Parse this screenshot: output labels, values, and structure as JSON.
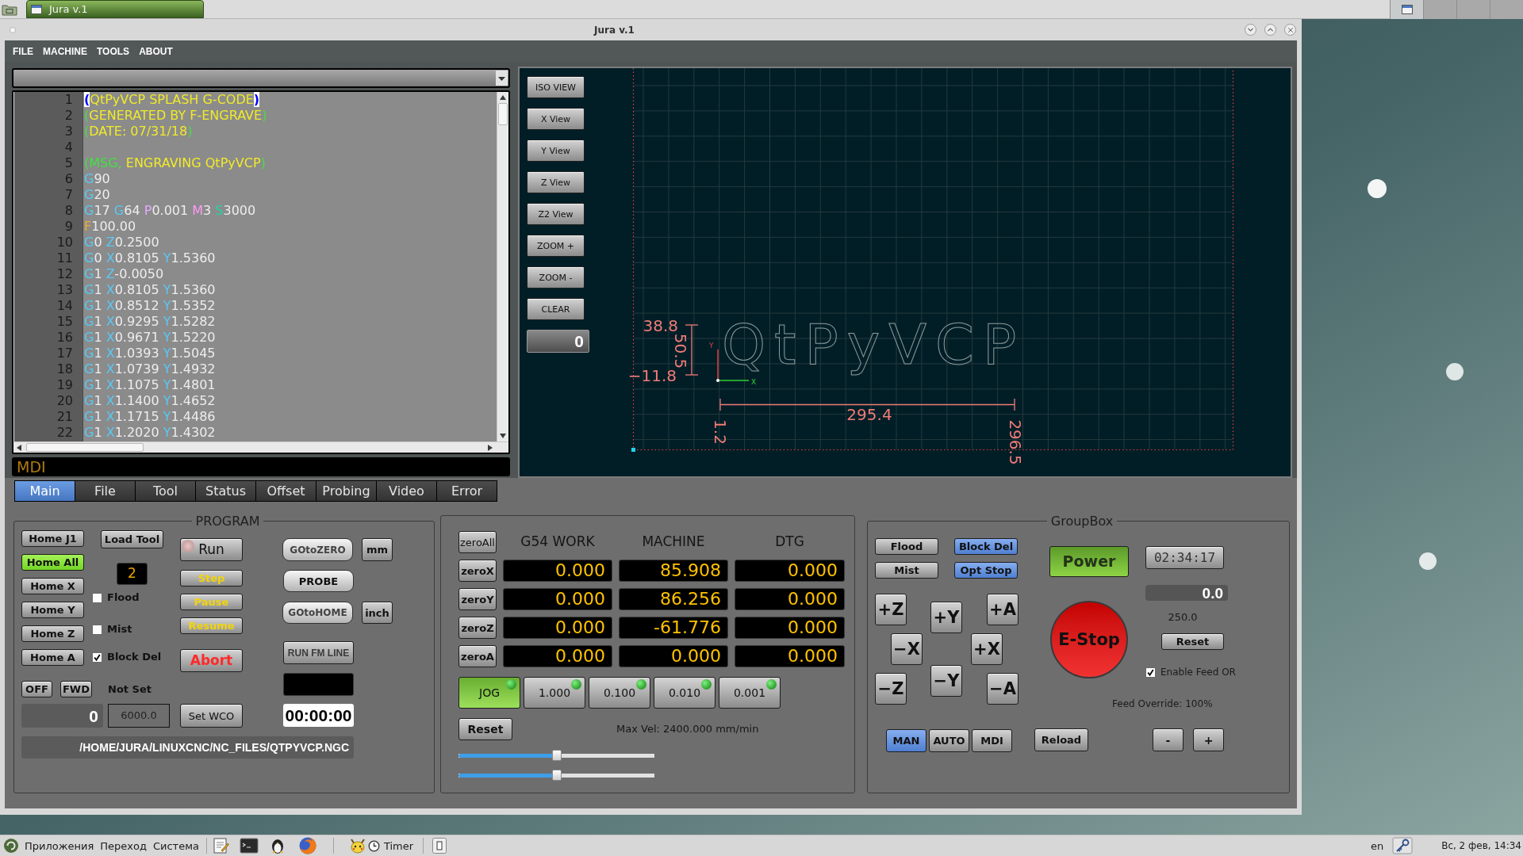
{
  "top_bar": {
    "window_buttons": [
      {
        "title": "Jura v.1",
        "selected": true
      }
    ],
    "workspaces": [
      {
        "selected": true
      },
      {
        "selected": false
      },
      {
        "selected": false
      },
      {
        "selected": false
      }
    ]
  },
  "window": {
    "title": "Jura v.1"
  },
  "menu": [
    "FILE",
    "MACHINE",
    "TOOLS",
    "ABOUT"
  ],
  "editor": {
    "lines": [
      {
        "number": "1",
        "tokens": [
          {
            "kind": "matched_paren",
            "text": "("
          },
          {
            "kind": "comment",
            "text": "QtPyVCP SPLASH G-CODE"
          },
          {
            "kind": "matched_paren",
            "text": ")"
          }
        ]
      },
      {
        "number": "2",
        "tokens": [
          {
            "kind": "paren",
            "text": "("
          },
          {
            "kind": "comment",
            "text": "GENERATED BY F-ENGRAVE"
          },
          {
            "kind": "paren",
            "text": ")"
          }
        ]
      },
      {
        "number": "3",
        "tokens": [
          {
            "kind": "paren",
            "text": "("
          },
          {
            "kind": "comment",
            "text": "DATE: 07/31/18"
          },
          {
            "kind": "paren",
            "text": ")"
          }
        ]
      },
      {
        "number": "4"
      },
      {
        "number": "5",
        "tokens": [
          {
            "kind": "paren",
            "text": "("
          },
          {
            "kind": "msg",
            "text": "MSG,"
          },
          {
            "kind": "comment",
            "text": " ENGRAVING QtPyVCP"
          },
          {
            "kind": "paren",
            "text": ")"
          }
        ]
      },
      {
        "number": "6",
        "tokens": [
          {
            "kind": "gcode",
            "text": "G"
          },
          {
            "kind": "value",
            "text": "90"
          }
        ]
      },
      {
        "number": "7",
        "tokens": [
          {
            "kind": "gcode",
            "text": "G"
          },
          {
            "kind": "value",
            "text": "20"
          }
        ]
      },
      {
        "number": "8",
        "tokens": [
          {
            "kind": "gcode",
            "text": "G"
          },
          {
            "kind": "value",
            "text": "17 "
          },
          {
            "kind": "gcode",
            "text": "G"
          },
          {
            "kind": "value",
            "text": "64 "
          },
          {
            "kind": "p_word",
            "text": "P"
          },
          {
            "kind": "value",
            "text": "0.001 "
          },
          {
            "kind": "m_word",
            "text": "M"
          },
          {
            "kind": "value",
            "text": "3 "
          },
          {
            "kind": "s_word",
            "text": "S"
          },
          {
            "kind": "value",
            "text": "3000"
          }
        ]
      },
      {
        "number": "9",
        "tokens": [
          {
            "kind": "f_word",
            "text": "F"
          },
          {
            "kind": "value",
            "text": "100.00"
          }
        ]
      },
      {
        "number": "10",
        "tokens": [
          {
            "kind": "gcode",
            "text": "G"
          },
          {
            "kind": "value",
            "text": "0 "
          },
          {
            "kind": "axis",
            "text": "Z"
          },
          {
            "kind": "value",
            "text": "0.2500"
          }
        ]
      },
      {
        "number": "11",
        "tokens": [
          {
            "kind": "gcode",
            "text": "G"
          },
          {
            "kind": "value",
            "text": "0 "
          },
          {
            "kind": "axis",
            "text": "X"
          },
          {
            "kind": "value",
            "text": "0.8105 "
          },
          {
            "kind": "axis",
            "text": "Y"
          },
          {
            "kind": "value",
            "text": "1.5360"
          }
        ]
      },
      {
        "number": "12",
        "tokens": [
          {
            "kind": "gcode",
            "text": "G"
          },
          {
            "kind": "value",
            "text": "1 "
          },
          {
            "kind": "axis",
            "text": "Z"
          },
          {
            "kind": "value",
            "text": "-0.0050"
          }
        ]
      },
      {
        "number": "13",
        "tokens": [
          {
            "kind": "gcode",
            "text": "G"
          },
          {
            "kind": "value",
            "text": "1 "
          },
          {
            "kind": "axis",
            "text": "X"
          },
          {
            "kind": "value",
            "text": "0.8105 "
          },
          {
            "kind": "axis",
            "text": "Y"
          },
          {
            "kind": "value",
            "text": "1.5360"
          }
        ]
      },
      {
        "number": "14",
        "tokens": [
          {
            "kind": "gcode",
            "text": "G"
          },
          {
            "kind": "value",
            "text": "1 "
          },
          {
            "kind": "axis",
            "text": "X"
          },
          {
            "kind": "value",
            "text": "0.8512 "
          },
          {
            "kind": "axis",
            "text": "Y"
          },
          {
            "kind": "value",
            "text": "1.5352"
          }
        ]
      },
      {
        "number": "15",
        "tokens": [
          {
            "kind": "gcode",
            "text": "G"
          },
          {
            "kind": "value",
            "text": "1 "
          },
          {
            "kind": "axis",
            "text": "X"
          },
          {
            "kind": "value",
            "text": "0.9295 "
          },
          {
            "kind": "axis",
            "text": "Y"
          },
          {
            "kind": "value",
            "text": "1.5282"
          }
        ]
      },
      {
        "number": "16",
        "tokens": [
          {
            "kind": "gcode",
            "text": "G"
          },
          {
            "kind": "value",
            "text": "1 "
          },
          {
            "kind": "axis",
            "text": "X"
          },
          {
            "kind": "value",
            "text": "0.9671 "
          },
          {
            "kind": "axis",
            "text": "Y"
          },
          {
            "kind": "value",
            "text": "1.5220"
          }
        ]
      },
      {
        "number": "17",
        "tokens": [
          {
            "kind": "gcode",
            "text": "G"
          },
          {
            "kind": "value",
            "text": "1 "
          },
          {
            "kind": "axis",
            "text": "X"
          },
          {
            "kind": "value",
            "text": "1.0393 "
          },
          {
            "kind": "axis",
            "text": "Y"
          },
          {
            "kind": "value",
            "text": "1.5045"
          }
        ]
      },
      {
        "number": "18",
        "tokens": [
          {
            "kind": "gcode",
            "text": "G"
          },
          {
            "kind": "value",
            "text": "1 "
          },
          {
            "kind": "axis",
            "text": "X"
          },
          {
            "kind": "value",
            "text": "1.0739 "
          },
          {
            "kind": "axis",
            "text": "Y"
          },
          {
            "kind": "value",
            "text": "1.4932"
          }
        ]
      },
      {
        "number": "19",
        "tokens": [
          {
            "kind": "gcode",
            "text": "G"
          },
          {
            "kind": "value",
            "text": "1 "
          },
          {
            "kind": "axis",
            "text": "X"
          },
          {
            "kind": "value",
            "text": "1.1075 "
          },
          {
            "kind": "axis",
            "text": "Y"
          },
          {
            "kind": "value",
            "text": "1.4801"
          }
        ]
      },
      {
        "number": "20",
        "tokens": [
          {
            "kind": "gcode",
            "text": "G"
          },
          {
            "kind": "value",
            "text": "1 "
          },
          {
            "kind": "axis",
            "text": "X"
          },
          {
            "kind": "value",
            "text": "1.1400 "
          },
          {
            "kind": "axis",
            "text": "Y"
          },
          {
            "kind": "value",
            "text": "1.4652"
          }
        ]
      },
      {
        "number": "21",
        "tokens": [
          {
            "kind": "gcode",
            "text": "G"
          },
          {
            "kind": "value",
            "text": "1 "
          },
          {
            "kind": "axis",
            "text": "X"
          },
          {
            "kind": "value",
            "text": "1.1715 "
          },
          {
            "kind": "axis",
            "text": "Y"
          },
          {
            "kind": "value",
            "text": "1.4486"
          }
        ]
      },
      {
        "number": "22",
        "tokens": [
          {
            "kind": "gcode",
            "text": "G"
          },
          {
            "kind": "value",
            "text": "1 "
          },
          {
            "kind": "axis",
            "text": "X"
          },
          {
            "kind": "value",
            "text": "1.2020 "
          },
          {
            "kind": "axis",
            "text": "Y"
          },
          {
            "kind": "value",
            "text": "1.4302"
          }
        ]
      }
    ]
  },
  "mdi": {
    "placeholder": "MDI"
  },
  "preview": {
    "view_buttons": [
      "ISO VIEW",
      "X View",
      "Y View",
      "Z View",
      "Z2 View",
      "ZOOM +",
      "ZOOM -",
      "CLEAR"
    ],
    "view_counter": "0",
    "toolpath_text": "QtPyVCP",
    "axis_labels": {
      "y": "Y",
      "x": "X"
    },
    "dimensions": {
      "y_max": "38.8",
      "y_size": "50.5",
      "y_min": "−11.8",
      "x_size": "295.4",
      "x_min": "1.2",
      "x_max": "296.5"
    }
  },
  "tabs": [
    {
      "label": "Main",
      "selected": true
    },
    {
      "label": "File",
      "selected": false
    },
    {
      "label": "Tool",
      "selected": false
    },
    {
      "label": "Status",
      "selected": false
    },
    {
      "label": "Offset",
      "selected": false
    },
    {
      "label": "Probing",
      "selected": false
    },
    {
      "label": "Video",
      "selected": false
    },
    {
      "label": "Error",
      "selected": false
    }
  ],
  "program": {
    "title": "PROGRAM",
    "home_buttons": [
      {
        "label": "Home J1",
        "active": false
      },
      {
        "label": "Home All",
        "active": true
      },
      {
        "label": "Home X",
        "active": false
      },
      {
        "label": "Home Y",
        "active": false
      },
      {
        "label": "Home Z",
        "active": false
      },
      {
        "label": "Home A",
        "active": false
      }
    ],
    "load_tool": "Load Tool",
    "tool_number": "2",
    "checks": [
      {
        "label": "Flood",
        "checked": false
      },
      {
        "label": "Mist",
        "checked": false
      },
      {
        "label": "Block Del",
        "checked": true
      }
    ],
    "run_led": {
      "on": false
    },
    "run_controls": [
      {
        "label": "Run",
        "kind": "run"
      },
      {
        "label": "Step",
        "kind": "action"
      },
      {
        "label": "Pause",
        "kind": "action"
      },
      {
        "label": "Resume",
        "kind": "action"
      },
      {
        "label": "Abort",
        "kind": "abort"
      }
    ],
    "goto_buttons": [
      "GOtoZERO",
      "PROBE",
      "GOtoHOME"
    ],
    "unit_buttons": [
      "mm",
      "inch"
    ],
    "run_from_line": "RUN FM LINE",
    "elapsed_time": "00:00:00",
    "spindle_buttons": [
      "OFF",
      "FWD"
    ],
    "spindle_status": "Not Set",
    "spindle_speed": "0",
    "spindle_max": "6000.0",
    "set_wco": "Set WCO",
    "file_path": "/HOME/JURA/LINUXCNC/NC_FILES/QTPYVCP.NGC"
  },
  "dro": {
    "zero_all": "zeroAll",
    "columns": [
      "G54 WORK",
      "MACHINE",
      "DTG"
    ],
    "rows": [
      {
        "button": "zeroX",
        "values": [
          "0.000",
          "85.908",
          "0.000"
        ]
      },
      {
        "button": "zeroY",
        "values": [
          "0.000",
          "86.256",
          "0.000"
        ]
      },
      {
        "button": "zeroZ",
        "values": [
          "0.000",
          "-61.776",
          "0.000"
        ]
      },
      {
        "button": "zeroA",
        "values": [
          "0.000",
          "0.000",
          "0.000"
        ]
      }
    ],
    "jog_steps": [
      {
        "label": "JOG",
        "selected": true,
        "led_on": true
      },
      {
        "label": "1.000",
        "selected": false,
        "led_on": true
      },
      {
        "label": "0.100",
        "selected": false,
        "led_on": true
      },
      {
        "label": "0.010",
        "selected": false,
        "led_on": true
      },
      {
        "label": "0.001",
        "selected": false,
        "led_on": true
      }
    ],
    "reset": "Reset",
    "max_velocity": "Max Vel: 2400.000 mm/min",
    "sliders": [
      {
        "level": 0.5
      },
      {
        "level": 0.5
      }
    ]
  },
  "group_box": {
    "title": "GroupBox",
    "toggles": [
      {
        "label": "Flood",
        "on": false
      },
      {
        "label": "Block Del",
        "on": true
      },
      {
        "label": "Mist",
        "on": false
      },
      {
        "label": "Opt Stop",
        "on": true
      }
    ],
    "power": {
      "label": "Power",
      "on": true
    },
    "estop": "E-Stop",
    "clock": "02:34:17",
    "feed_value": "0.0",
    "feed_max": "250.0",
    "reset": "Reset",
    "enable_feed_override": {
      "label": "Enable Feed OR",
      "checked": true
    },
    "feed_override": "Feed Override: 100%",
    "jog_buttons": [
      "+Z",
      "+Y",
      "+A",
      "−X",
      "+X",
      "−Z",
      "−Y",
      "−A"
    ],
    "modes": [
      {
        "label": "MAN",
        "selected": true
      },
      {
        "label": "AUTO",
        "selected": false
      },
      {
        "label": "MDI",
        "selected": false
      }
    ],
    "reload": "Reload",
    "override_buttons": [
      "-",
      "+"
    ]
  },
  "bottom_panel": {
    "menus": [
      "Приложения",
      "Переход",
      "Система"
    ],
    "timer_applet": "Timer",
    "keyboard_layout": "en",
    "clock": "Вс, 2 фев, 14:34"
  }
}
